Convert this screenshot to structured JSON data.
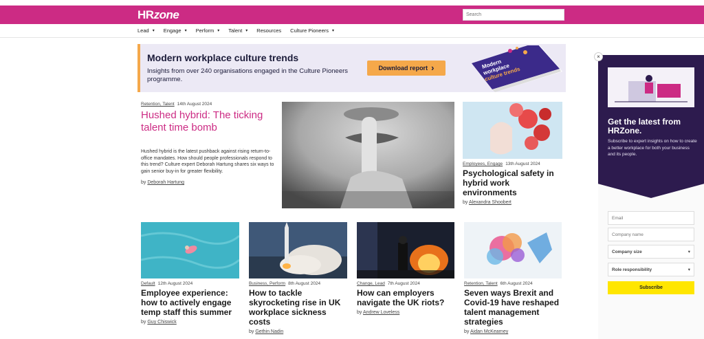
{
  "header": {
    "logo_hr": "HR",
    "logo_zone": "zone",
    "search_placeholder": "Search"
  },
  "nav": {
    "items": [
      {
        "label": "Lead",
        "dropdown": "▾"
      },
      {
        "label": "Engage",
        "dropdown": "▾"
      },
      {
        "label": "Perform",
        "dropdown": "▾"
      },
      {
        "label": "Talent",
        "dropdown": "▾"
      },
      {
        "label": "Resources",
        "dropdown": ""
      },
      {
        "label": "Culture Pioneers",
        "dropdown": "▾"
      }
    ]
  },
  "banner": {
    "title": "Modern workplace culture trends",
    "text": "Insights from over 240 organisations engaged in the Culture Pioneers programme.",
    "button": "Download report",
    "button_icon": "›",
    "book_title_1": "Modern",
    "book_title_2": "workplace",
    "book_title_3": "culture trends"
  },
  "featured": {
    "categories": "Retention, Talent",
    "date": "14th August 2024",
    "title": "Hushed hybrid: The ticking talent time bomb",
    "description": "Hushed hybrid is the latest pushback against rising return-to-office mandates. How should people professionals respond to this trend? Culture expert Deborah Hartung shares six ways to gain senior buy-in for greater flexibility.",
    "by": "by",
    "author": "Deborah Hartung"
  },
  "side_article": {
    "categories": "Employees, Engage",
    "date": "13th August 2024",
    "title": "Psychological safety in hybrid work environments",
    "by": "by",
    "author": "Alexandra Shoobert"
  },
  "cards": [
    {
      "categories": "Default",
      "date": "12th August 2024",
      "title": "Employee experience: how to actively engage temp staff this summer",
      "by": "by",
      "author": "Guy Chiswick"
    },
    {
      "categories": "Business, Perform",
      "date": "8th August 2024",
      "title": "How to tackle skyrocketing rise in UK workplace sickness costs",
      "by": "by",
      "author": "Gethin Nadin"
    },
    {
      "categories": "Change, Lead",
      "date": "7th August 2024",
      "title": "How can employers navigate the UK riots?",
      "by": "by",
      "author": "Andrew Loveless"
    },
    {
      "categories": "Retention, Talent",
      "date": "6th August 2024",
      "title": "Seven ways Brexit and Covid-19 have reshaped talent management strategies",
      "by": "by",
      "author": "Aidan McKearney"
    }
  ],
  "sidebar": {
    "close": "×",
    "title": "Get the latest from HRZone.",
    "text": "Subscribe to expert insights on how to create a better workplace for both your business and its people.",
    "email_placeholder": "Email",
    "company_placeholder": "Company name",
    "company_size": "Company size",
    "role": "Role responsibility",
    "select_caret": "▾",
    "submit": "Subscribe"
  },
  "colors": {
    "brand": "#cc2b84",
    "sidebar_bg": "#2d1b4e",
    "cta": "#f5a84a",
    "subscribe": "#ffe600"
  }
}
